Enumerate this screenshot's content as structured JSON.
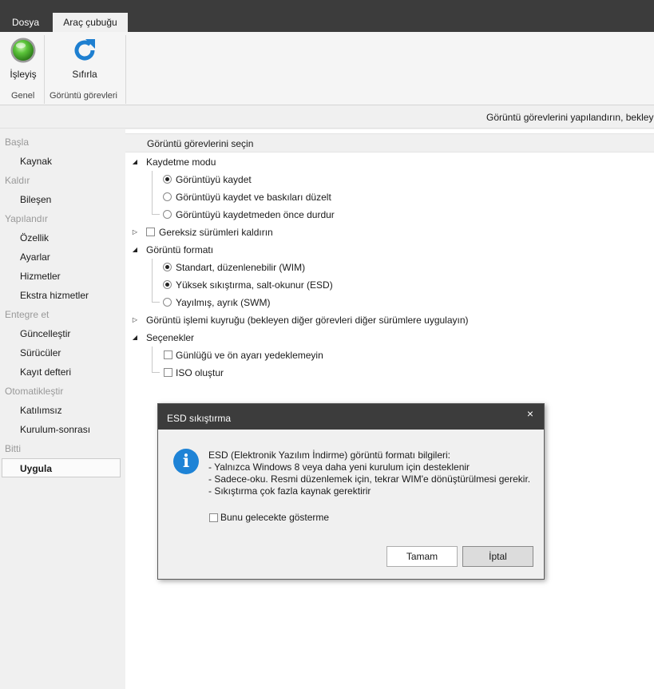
{
  "tabs": {
    "file": "Dosya",
    "toolbar": "Araç çubuğu"
  },
  "ribbon": {
    "process_label": "İşleyiş",
    "reset_label": "Sıfırla",
    "group_general": "Genel",
    "group_image_tasks": "Görüntü görevleri",
    "process_icon": "green-orb-icon",
    "reset_icon": "refresh-icon"
  },
  "status": {
    "text": "Görüntü görevlerini yapılandırın, bekleyen"
  },
  "sidebar": {
    "items": [
      {
        "label": "Başla",
        "kind": "header"
      },
      {
        "label": "Kaynak",
        "kind": "sub"
      },
      {
        "label": "Kaldır",
        "kind": "header"
      },
      {
        "label": "Bileşen",
        "kind": "sub"
      },
      {
        "label": "Yapılandır",
        "kind": "header"
      },
      {
        "label": "Özellik",
        "kind": "sub"
      },
      {
        "label": "Ayarlar",
        "kind": "sub"
      },
      {
        "label": "Hizmetler",
        "kind": "sub"
      },
      {
        "label": "Ekstra hizmetler",
        "kind": "sub"
      },
      {
        "label": "Entegre et",
        "kind": "header"
      },
      {
        "label": "Güncelleştir",
        "kind": "sub"
      },
      {
        "label": "Sürücüler",
        "kind": "sub"
      },
      {
        "label": "Kayıt defteri",
        "kind": "sub"
      },
      {
        "label": "Otomatikleştir",
        "kind": "header"
      },
      {
        "label": "Katılımsız",
        "kind": "sub"
      },
      {
        "label": "Kurulum-sonrası",
        "kind": "sub"
      },
      {
        "label": "Bitti",
        "kind": "header"
      },
      {
        "label": "Uygula",
        "kind": "selected"
      }
    ]
  },
  "main": {
    "section_title": "Görüntü görevlerini seçin",
    "save_mode": {
      "label": "Kaydetme modu",
      "options": [
        {
          "label": "Görüntüyü kaydet",
          "selected": true
        },
        {
          "label": "Görüntüyü kaydet ve baskıları düzelt",
          "selected": false
        },
        {
          "label": "Görüntüyü kaydetmeden önce durdur",
          "selected": false
        }
      ]
    },
    "remove_unneeded": {
      "label": "Gereksiz sürümleri kaldırın",
      "checked": false
    },
    "image_format": {
      "label": "Görüntü formatı",
      "options": [
        {
          "label": "Standart, düzenlenebilir (WIM)",
          "selected": true
        },
        {
          "label": "Yüksek sıkıştırma, salt-okunur (ESD)",
          "selected": true
        },
        {
          "label": "Yayılmış, ayrık (SWM)",
          "selected": false
        }
      ]
    },
    "queue": {
      "label": "Görüntü işlemi kuyruğu (bekleyen diğer görevleri diğer sürümlere uygulayın)"
    },
    "options": {
      "label": "Seçenekler",
      "items": [
        {
          "label": "Günlüğü ve ön ayarı yedeklemeyin",
          "checked": false
        },
        {
          "label": "ISO oluştur",
          "checked": false
        }
      ]
    }
  },
  "dialog": {
    "title": "ESD sıkıştırma",
    "close_glyph": "×",
    "lines": [
      "ESD (Elektronik Yazılım İndirme) görüntü formatı bilgileri:",
      " - Yalnızca Windows 8 veya daha yeni kurulum için desteklenir",
      " - Sadece-oku. Resmi düzenlemek için, tekrar WIM'e dönüştürülmesi gerekir.",
      " - Sıkıştırma çok fazla kaynak gerektirir"
    ],
    "dont_show_label": "Bunu gelecekte gösterme",
    "dont_show_checked": false,
    "ok_label": "Tamam",
    "cancel_label": "İptal",
    "icon": "info-icon"
  }
}
